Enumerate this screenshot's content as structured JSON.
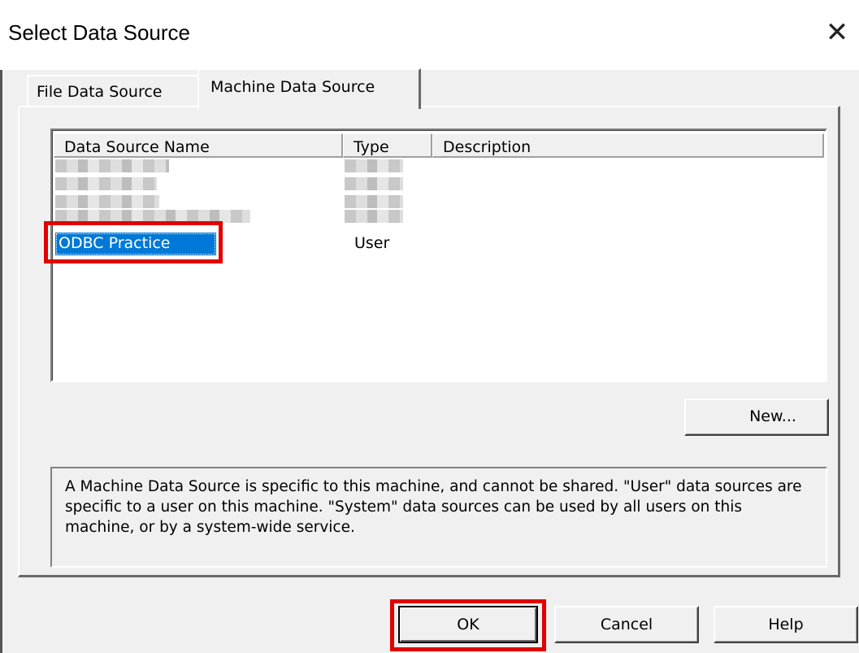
{
  "window": {
    "title": "Select Data Source",
    "close_glyph": "✕"
  },
  "tabs": [
    {
      "label": "File Data Source",
      "active": false
    },
    {
      "label": "Machine Data Source",
      "active": true
    }
  ],
  "list": {
    "columns": [
      "Data Source Name",
      "Type",
      "Description"
    ],
    "rows": [
      {
        "name": "ODBC Practice",
        "type": "User",
        "description": "",
        "selected": true
      }
    ]
  },
  "buttons": {
    "new": "New...",
    "ok": "OK",
    "cancel": "Cancel",
    "help": "Help"
  },
  "description": "A Machine Data Source is specific to this machine, and cannot be shared. \"User\" data sources are specific to a user on this machine. \"System\" data sources can be used by all users on this machine, or by a system-wide service.",
  "colors": {
    "selection": "#0078d7",
    "highlight_annotation": "#e00000"
  }
}
